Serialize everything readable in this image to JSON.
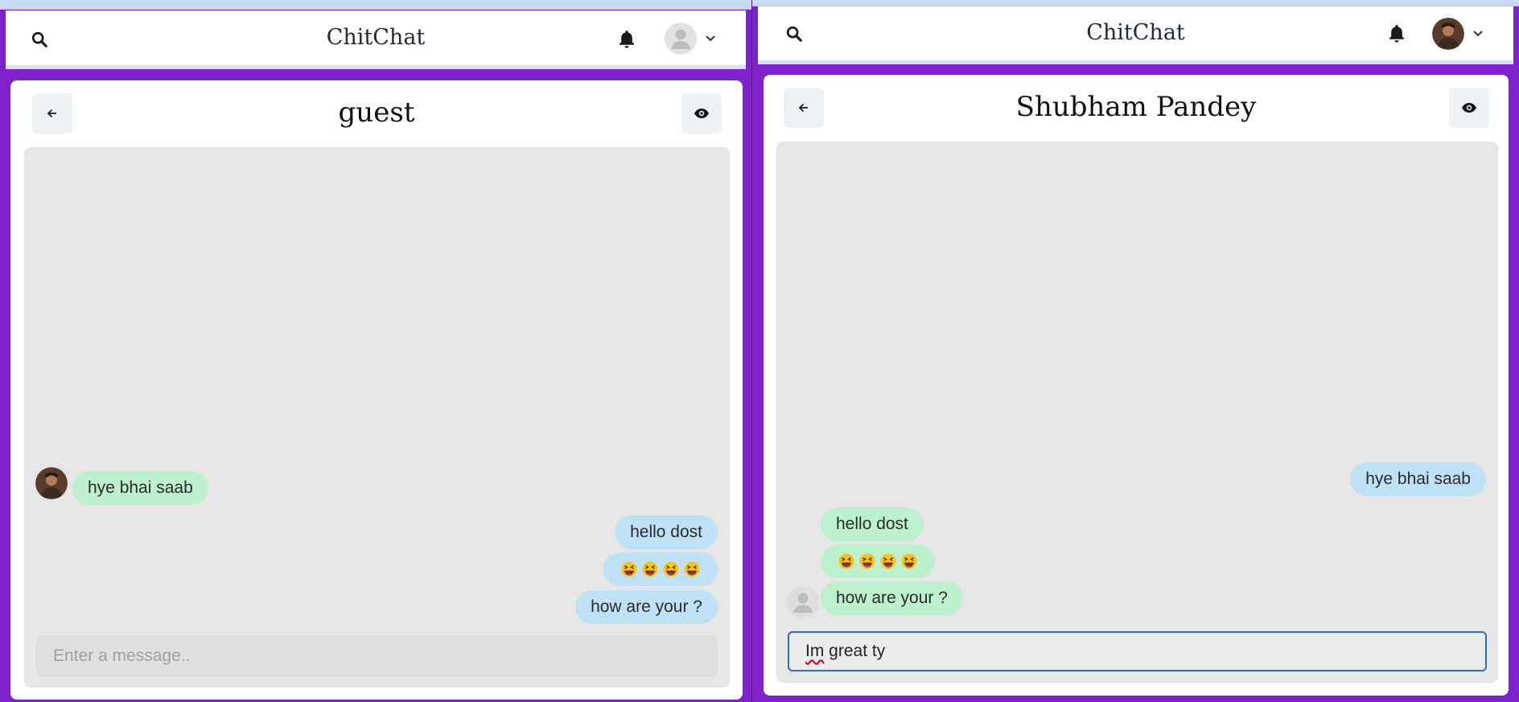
{
  "left_window": {
    "header": {
      "app_title": "ChitChat",
      "search_icon": "search-icon",
      "bell_icon": "bell-icon",
      "avatar": "default-avatar",
      "menu_icon": "chevron-down-icon"
    },
    "chat": {
      "title": "guest",
      "back_icon": "arrow-left-icon",
      "view_icon": "eye-icon",
      "messages": [
        {
          "text": "hye bhai saab",
          "side": "left",
          "with_avatar": true
        },
        {
          "text": "hello dost",
          "side": "right"
        },
        {
          "emoji_count": 4,
          "emoji": "grinning-squinting-face",
          "side": "right"
        },
        {
          "text": "how are your ?",
          "side": "right"
        }
      ],
      "input": {
        "placeholder": "Enter a message..",
        "value": ""
      }
    }
  },
  "right_window": {
    "header": {
      "app_title": "ChitChat",
      "search_icon": "search-icon",
      "bell_icon": "bell-icon",
      "avatar": "user-photo-avatar",
      "menu_icon": "chevron-down-icon"
    },
    "chat": {
      "title": "Shubham Pandey",
      "back_icon": "arrow-left-icon",
      "view_icon": "eye-icon",
      "messages": [
        {
          "text": "hye bhai saab",
          "side": "right"
        },
        {
          "text": "hello dost",
          "side": "left"
        },
        {
          "emoji_count": 4,
          "emoji": "grinning-squinting-face",
          "side": "left"
        },
        {
          "text": "how are your ?",
          "side": "left",
          "with_avatar": true
        }
      ],
      "input": {
        "value_misspelled": "Im",
        "value_rest": " great ty"
      }
    }
  },
  "colors": {
    "frame_purple": "#7e23cc",
    "sender_bubble": "#bfe1f6",
    "receiver_bubble": "#bdf1cd",
    "message_area": "#e6e6e6",
    "input_focus_border": "#2e6cc0"
  }
}
